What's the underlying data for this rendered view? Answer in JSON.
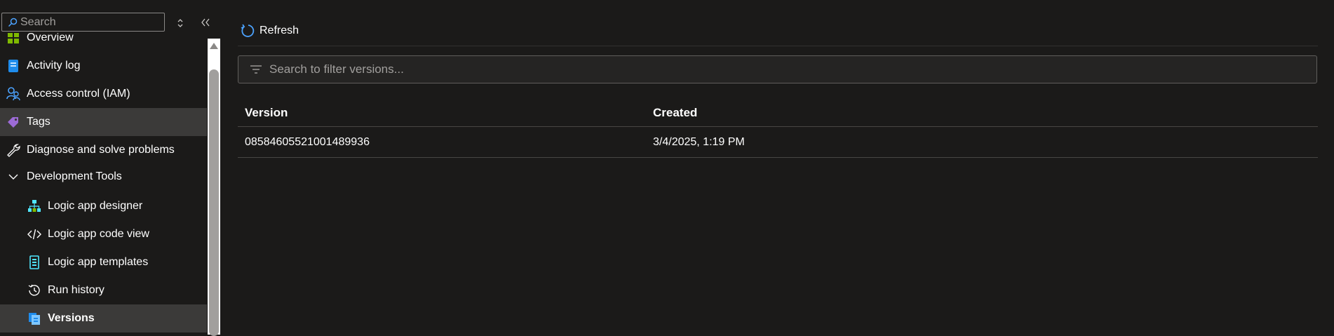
{
  "sidebar": {
    "search_placeholder": "Search",
    "items": [
      {
        "label": "Overview",
        "icon": "overview-icon"
      },
      {
        "label": "Activity log",
        "icon": "activity-log-icon"
      },
      {
        "label": "Access control (IAM)",
        "icon": "access-control-icon"
      },
      {
        "label": "Tags",
        "icon": "tags-icon"
      },
      {
        "label": "Diagnose and solve problems",
        "icon": "wrench-icon"
      },
      {
        "label": "Development Tools",
        "icon": "chevron-down-icon"
      },
      {
        "label": "Logic app designer",
        "icon": "designer-icon"
      },
      {
        "label": "Logic app code view",
        "icon": "code-icon"
      },
      {
        "label": "Logic app templates",
        "icon": "templates-icon"
      },
      {
        "label": "Run history",
        "icon": "history-icon"
      },
      {
        "label": "Versions",
        "icon": "versions-icon"
      }
    ]
  },
  "toolbar": {
    "refresh_label": "Refresh"
  },
  "filter": {
    "placeholder": "Search to filter versions..."
  },
  "table": {
    "columns": [
      "Version",
      "Created"
    ],
    "rows": [
      [
        "08584605521001489936",
        "3/4/2025, 1:19 PM"
      ]
    ]
  },
  "colors": {
    "background": "#1b1a19",
    "selected": "#3b3a39",
    "accent": "#0078d4"
  }
}
